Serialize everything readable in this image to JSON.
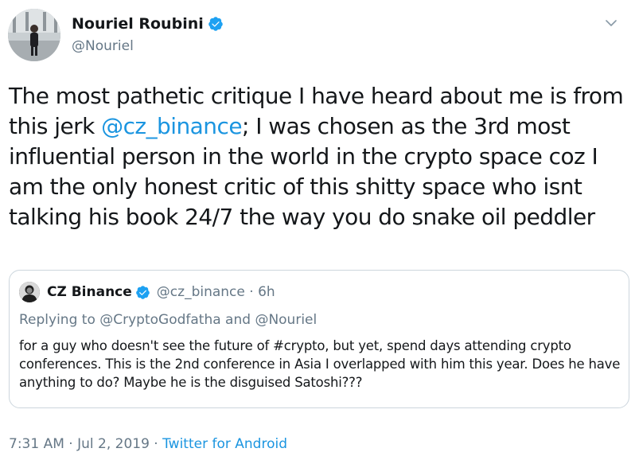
{
  "author": {
    "name": "Nouriel Roubini",
    "handle": "@Nouriel"
  },
  "tweet": {
    "text_before": "The most pathetic critique I have heard about me is from\nthis jerk ",
    "mention": "@cz_binance",
    "text_after": "; I was chosen as the 3rd most\ninfluential person in the world in the crypto space coz I\nam the only honest critic of this shitty space who isnt\ntalking his book 24/7 the way you do snake oil peddler"
  },
  "quote": {
    "name": "CZ Binance",
    "handle_time": "@cz_binance · 6h",
    "replying_to": "Replying to @CryptoGodfatha and @Nouriel",
    "text": "for a guy who doesn't see the future of #crypto, but yet, spend days attending crypto conferences.  This is the 2nd conference in Asia I overlapped with him this year.  Does he have anything to do?  Maybe he is the disguised Satoshi???"
  },
  "meta": {
    "timestamp": "7:31 AM · Jul 2, 2019 · ",
    "source": "Twitter for Android"
  },
  "colors": {
    "link": "#1b95e0",
    "secondary_text": "#657786",
    "verified_badge": "#1da1f2",
    "border": "#ccd6dd"
  },
  "icons": {
    "verified": "verified-badge-icon",
    "more": "chevron-down-icon"
  }
}
